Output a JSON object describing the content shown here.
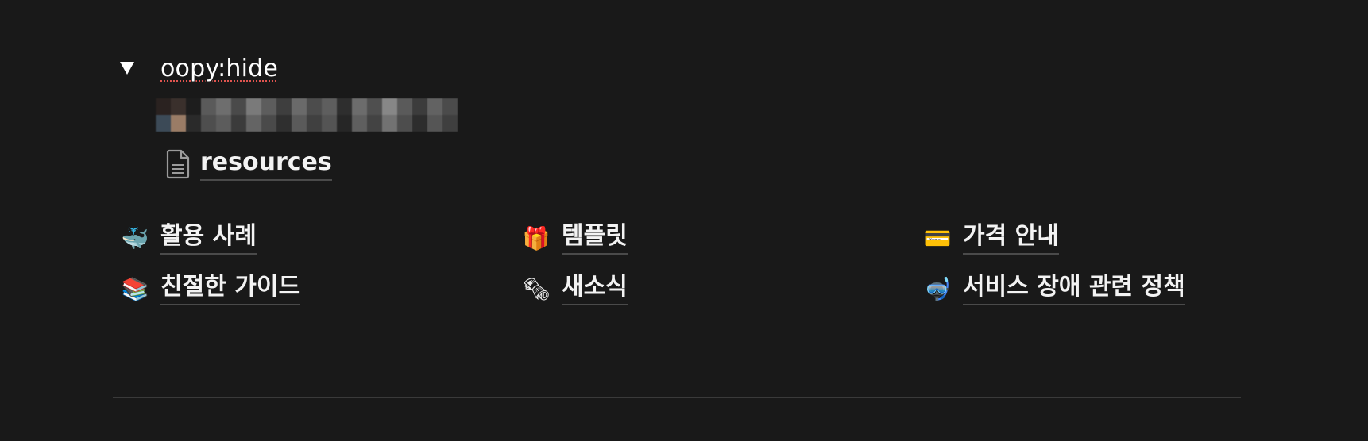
{
  "toggle": {
    "title": "oopy:hide",
    "children": {
      "page_link_label": "resources"
    }
  },
  "links": [
    {
      "emoji": "🐳",
      "icon": "whale-icon",
      "label": "활용 사례"
    },
    {
      "emoji": "🎁",
      "icon": "gift-icon",
      "label": "템플릿"
    },
    {
      "emoji": "💳",
      "icon": "credit-card-icon",
      "label": "가격 안내"
    },
    {
      "emoji": "📚",
      "icon": "books-icon",
      "label": "친절한 가이드"
    },
    {
      "emoji": "🗞",
      "icon": "newspaper-icon",
      "label": "새소식"
    },
    {
      "emoji": "🤿",
      "icon": "diving-mask-icon",
      "label": "서비스 장애 관련 정책"
    }
  ]
}
